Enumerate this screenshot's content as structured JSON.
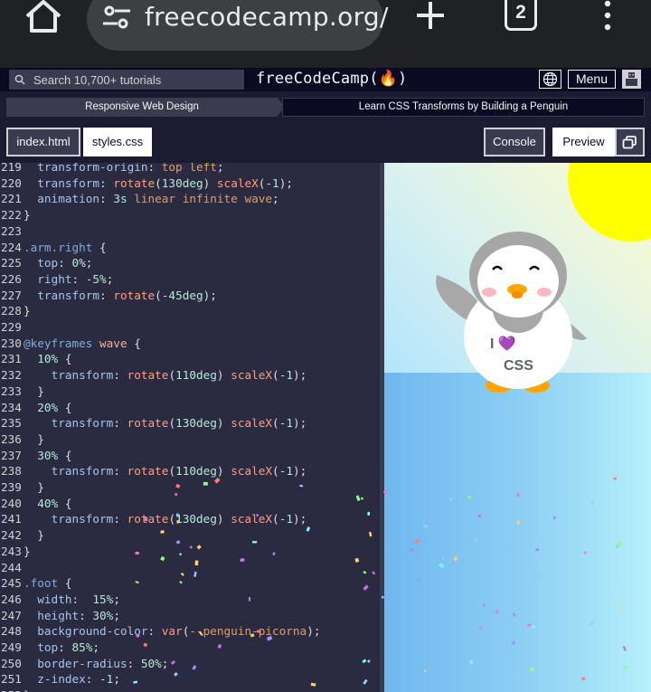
{
  "browser": {
    "url": "freecodecamp.org/",
    "tab_count": "2",
    "icons": [
      "home-icon",
      "tune-icon",
      "plus-icon",
      "tab-switcher-icon",
      "more-vert-icon"
    ]
  },
  "nav": {
    "search_placeholder": "Search 10,700+ tutorials",
    "brand": "freeCodeCamp(🔥)",
    "menu_label": "Menu"
  },
  "breadcrumb": {
    "course": "Responsive Web Design",
    "project": "Learn CSS Transforms by Building a Penguin"
  },
  "tabs": {
    "index": "index.html",
    "styles": "styles.css",
    "console": "Console",
    "preview": "Preview"
  },
  "editor": {
    "lines": [
      {
        "n": "219",
        "t": [
          [
            "  ",
            ""
          ],
          [
            "transform-origin",
            "t-prop"
          ],
          [
            ": ",
            "t-p"
          ],
          [
            "top left",
            "t-kw"
          ],
          [
            ";",
            "t-p"
          ]
        ]
      },
      {
        "n": "220",
        "t": [
          [
            "  ",
            ""
          ],
          [
            "transform",
            "t-prop"
          ],
          [
            ": ",
            "t-p"
          ],
          [
            "rotate",
            "t-fn"
          ],
          [
            "(",
            "t-p"
          ],
          [
            "130deg",
            "t-num"
          ],
          [
            ") ",
            "t-p"
          ],
          [
            "scaleX",
            "t-fn"
          ],
          [
            "(",
            "t-p"
          ],
          [
            "-1",
            "t-num"
          ],
          [
            ");",
            "t-p"
          ]
        ]
      },
      {
        "n": "221",
        "t": [
          [
            "  ",
            ""
          ],
          [
            "animation",
            "t-prop"
          ],
          [
            ": ",
            "t-p"
          ],
          [
            "3s",
            "t-num"
          ],
          [
            " ",
            "t-p"
          ],
          [
            "linear infinite wave",
            "t-kw"
          ],
          [
            ";",
            "t-p"
          ]
        ]
      },
      {
        "n": "222",
        "t": [
          [
            "}",
            "t-p"
          ]
        ]
      },
      {
        "n": "223",
        "t": []
      },
      {
        "n": "224",
        "t": [
          [
            ".arm.right",
            "t-sel"
          ],
          [
            " {",
            "t-p"
          ]
        ]
      },
      {
        "n": "225",
        "t": [
          [
            "  ",
            ""
          ],
          [
            "top",
            "t-prop"
          ],
          [
            ": ",
            "t-p"
          ],
          [
            "0%",
            "t-num"
          ],
          [
            ";",
            "t-p"
          ]
        ]
      },
      {
        "n": "226",
        "t": [
          [
            "  ",
            ""
          ],
          [
            "right",
            "t-prop"
          ],
          [
            ": ",
            "t-p"
          ],
          [
            "-5%",
            "t-num"
          ],
          [
            ";",
            "t-p"
          ]
        ]
      },
      {
        "n": "227",
        "t": [
          [
            "  ",
            ""
          ],
          [
            "transform",
            "t-prop"
          ],
          [
            ": ",
            "t-p"
          ],
          [
            "rotate",
            "t-fn"
          ],
          [
            "(",
            "t-p"
          ],
          [
            "-45deg",
            "t-num"
          ],
          [
            ");",
            "t-p"
          ]
        ]
      },
      {
        "n": "228",
        "t": [
          [
            "}",
            "t-p"
          ]
        ]
      },
      {
        "n": "229",
        "t": []
      },
      {
        "n": "230",
        "t": [
          [
            "@keyframes",
            "t-at"
          ],
          [
            " ",
            "t-p"
          ],
          [
            "wave",
            "t-name"
          ],
          [
            " {",
            "t-p"
          ]
        ]
      },
      {
        "n": "231",
        "t": [
          [
            "  ",
            ""
          ],
          [
            "10%",
            "t-num"
          ],
          [
            " {",
            "t-p"
          ]
        ]
      },
      {
        "n": "232",
        "t": [
          [
            "    ",
            ""
          ],
          [
            "transform",
            "t-prop"
          ],
          [
            ": ",
            "t-p"
          ],
          [
            "rotate",
            "t-fn"
          ],
          [
            "(",
            "t-p"
          ],
          [
            "110deg",
            "t-num"
          ],
          [
            ") ",
            "t-p"
          ],
          [
            "scaleX",
            "t-fn"
          ],
          [
            "(",
            "t-p"
          ],
          [
            "-1",
            "t-num"
          ],
          [
            ");",
            "t-p"
          ]
        ]
      },
      {
        "n": "233",
        "t": [
          [
            "  }",
            "t-p"
          ]
        ]
      },
      {
        "n": "234",
        "t": [
          [
            "  ",
            ""
          ],
          [
            "20%",
            "t-num"
          ],
          [
            " {",
            "t-p"
          ]
        ]
      },
      {
        "n": "235",
        "t": [
          [
            "    ",
            ""
          ],
          [
            "transform",
            "t-prop"
          ],
          [
            ": ",
            "t-p"
          ],
          [
            "rotate",
            "t-fn"
          ],
          [
            "(",
            "t-p"
          ],
          [
            "130deg",
            "t-num"
          ],
          [
            ") ",
            "t-p"
          ],
          [
            "scaleX",
            "t-fn"
          ],
          [
            "(",
            "t-p"
          ],
          [
            "-1",
            "t-num"
          ],
          [
            ");",
            "t-p"
          ]
        ]
      },
      {
        "n": "236",
        "t": [
          [
            "  }",
            "t-p"
          ]
        ]
      },
      {
        "n": "237",
        "t": [
          [
            "  ",
            ""
          ],
          [
            "30%",
            "t-num"
          ],
          [
            " {",
            "t-p"
          ]
        ]
      },
      {
        "n": "238",
        "t": [
          [
            "    ",
            ""
          ],
          [
            "transform",
            "t-prop"
          ],
          [
            ": ",
            "t-p"
          ],
          [
            "rotate",
            "t-fn"
          ],
          [
            "(",
            "t-p"
          ],
          [
            "110deg",
            "t-num"
          ],
          [
            ") ",
            "t-p"
          ],
          [
            "scaleX",
            "t-fn"
          ],
          [
            "(",
            "t-p"
          ],
          [
            "-1",
            "t-num"
          ],
          [
            ");",
            "t-p"
          ]
        ]
      },
      {
        "n": "239",
        "t": [
          [
            "  }",
            "t-p"
          ]
        ]
      },
      {
        "n": "240",
        "t": [
          [
            "  ",
            ""
          ],
          [
            "40%",
            "t-num"
          ],
          [
            " {",
            "t-p"
          ]
        ]
      },
      {
        "n": "241",
        "t": [
          [
            "    ",
            ""
          ],
          [
            "transform",
            "t-prop"
          ],
          [
            ": ",
            "t-p"
          ],
          [
            "rotate",
            "t-fn"
          ],
          [
            "(",
            "t-p"
          ],
          [
            "130deg",
            "t-num"
          ],
          [
            ") ",
            "t-p"
          ],
          [
            "scaleX",
            "t-fn"
          ],
          [
            "(",
            "t-p"
          ],
          [
            "-1",
            "t-num"
          ],
          [
            ");",
            "t-p"
          ]
        ]
      },
      {
        "n": "242",
        "t": [
          [
            "  }",
            "t-p"
          ]
        ]
      },
      {
        "n": "243",
        "t": [
          [
            "}",
            "t-p"
          ]
        ]
      },
      {
        "n": "244",
        "t": []
      },
      {
        "n": "245",
        "t": [
          [
            ".foot",
            "t-sel"
          ],
          [
            " {",
            "t-p"
          ]
        ]
      },
      {
        "n": "246",
        "t": [
          [
            "  ",
            ""
          ],
          [
            "width",
            "t-prop"
          ],
          [
            ":  ",
            "t-p"
          ],
          [
            "15%",
            "t-num"
          ],
          [
            ";",
            "t-p"
          ]
        ]
      },
      {
        "n": "247",
        "t": [
          [
            "  ",
            ""
          ],
          [
            "height",
            "t-prop"
          ],
          [
            ": ",
            "t-p"
          ],
          [
            "30%",
            "t-num"
          ],
          [
            ";",
            "t-p"
          ]
        ]
      },
      {
        "n": "248",
        "t": [
          [
            "  ",
            ""
          ],
          [
            "background-color",
            "t-prop"
          ],
          [
            ": ",
            "t-p"
          ],
          [
            "var",
            "t-fn"
          ],
          [
            "(",
            "t-p"
          ],
          [
            "--penguin-picorna",
            "t-kw"
          ],
          [
            ");",
            "t-p"
          ]
        ]
      },
      {
        "n": "249",
        "t": [
          [
            "  ",
            ""
          ],
          [
            "top",
            "t-prop"
          ],
          [
            ": ",
            "t-p"
          ],
          [
            "85%",
            "t-num"
          ],
          [
            ";",
            "t-p"
          ]
        ]
      },
      {
        "n": "250",
        "t": [
          [
            "  ",
            ""
          ],
          [
            "border-radius",
            "t-prop"
          ],
          [
            ": ",
            "t-p"
          ],
          [
            "50%",
            "t-num"
          ],
          [
            ";",
            "t-p"
          ]
        ]
      },
      {
        "n": "251",
        "t": [
          [
            "  ",
            ""
          ],
          [
            "z-index",
            "t-prop"
          ],
          [
            ": ",
            "t-p"
          ],
          [
            "-1",
            "t-num"
          ],
          [
            ";",
            "t-p"
          ]
        ]
      },
      {
        "n": "252",
        "t": [
          [
            "}",
            "t-p"
          ]
        ]
      }
    ]
  },
  "preview": {
    "penguin_text_1": "I 💜",
    "penguin_text_2": "CSS",
    "colors": {
      "sun": "#ffff00",
      "penguin_gray": "#9e9e9e",
      "penguin_white": "#ffffff",
      "beak_feet": "#ffa500",
      "cheeks": "#ffb6c1"
    }
  }
}
